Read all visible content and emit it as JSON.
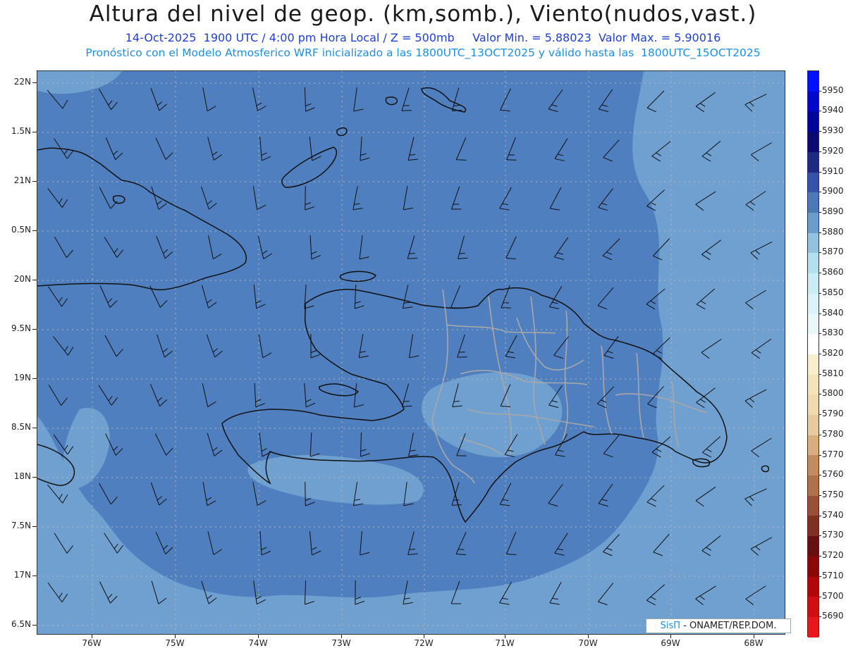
{
  "title": "Altura del nivel de geop. (km,somb.), Viento(nudos,vast.)",
  "subtitle_line1": "14-Oct-2025  1900 UTC / 4:00 pm Hora Local / Z = 500mb     Valor Min. = 5.88023  Valor Max. = 5.90016",
  "subtitle_line2": "Pronóstico con el Modelo Atmosferico WRF inicializado a las 1800UTC_13OCT2025 y válido hasta las  1800UTC_15OCT2025",
  "lat_labels": [
    "22N",
    "1.5N",
    "21N",
    "0.5N",
    "20N",
    "9.5N",
    "19N",
    "8.5N",
    "18N",
    "7.5N",
    "17N",
    "6.5N"
  ],
  "lon_labels": [
    "76W",
    "75W",
    "74W",
    "73W",
    "72W",
    "71W",
    "70W",
    "69W",
    "68W"
  ],
  "colorbar": {
    "labels": [
      "5950",
      "5940",
      "5930",
      "5920",
      "5910",
      "5900",
      "5890",
      "5880",
      "5870",
      "5860",
      "5850",
      "5840",
      "5830",
      "5820",
      "5810",
      "5800",
      "5790",
      "5780",
      "5770",
      "5760",
      "5750",
      "5740",
      "5730",
      "5720",
      "5710",
      "5700",
      "5690"
    ],
    "colors": [
      "#0010ff",
      "#0008cc",
      "#00069a",
      "#0a0a70",
      "#1e2a80",
      "#3452a8",
      "#4c78b8",
      "#6a9ccc",
      "#92c2de",
      "#b4e0ee",
      "#caecf4",
      "#daf2f8",
      "#e8f8fa",
      "#ffffff",
      "#f8eecc",
      "#f4e4bc",
      "#f0dab0",
      "#e8caa0",
      "#d8ae7c",
      "#c48c5c",
      "#b07048",
      "#9a5038",
      "#803020",
      "#681010",
      "#8a0808",
      "#b00808",
      "#d01010",
      "#e81818"
    ]
  },
  "credit": {
    "brand": "SisΠ",
    "text": " - ONAMET/REP.DOM."
  },
  "field_colors": {
    "main": "#4f7fbf",
    "light": "#6fa0cf",
    "land_border": "#111111",
    "province_border": "#a8a8a8",
    "grid": "#b8b8b8",
    "barb": "#111111"
  }
}
